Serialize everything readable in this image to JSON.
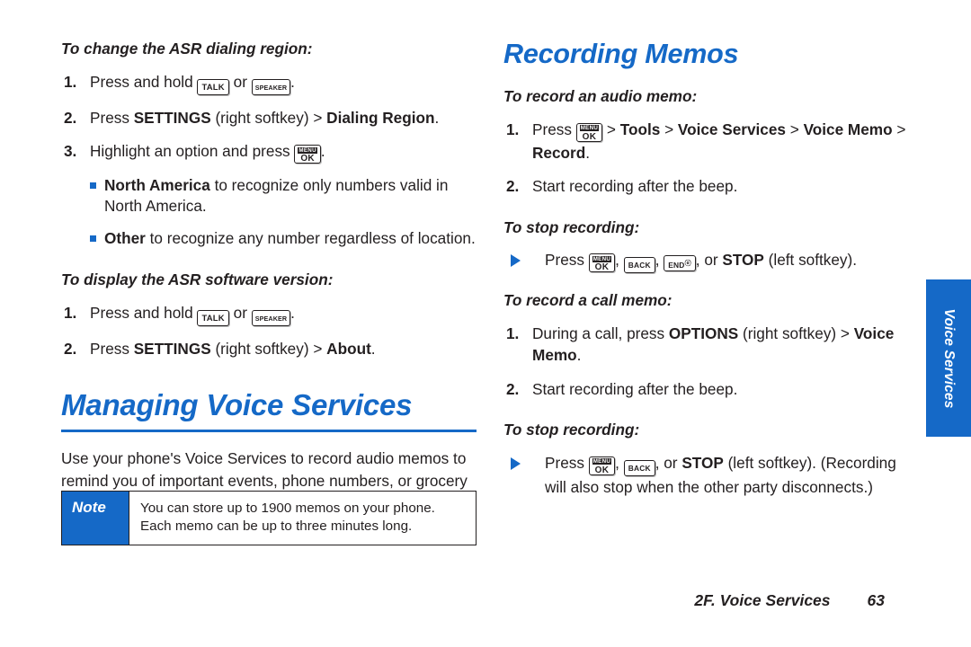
{
  "colors": {
    "accent": "#1569c7",
    "text": "#231f20",
    "page_bg": "#ffffff"
  },
  "left_column": {
    "proc1_heading": "To change the ASR dialing region:",
    "proc1_steps": {
      "s1_num": "1.",
      "s1_a": "Press and hold ",
      "s1_or": " or ",
      "s1_end": ".",
      "s2_num": "2.",
      "s2_a": "Press ",
      "s2_b1": "SETTINGS",
      "s2_c": " (right softkey) > ",
      "s2_b2": "Dialing Region",
      "s2_end": ".",
      "s3_num": "3.",
      "s3_a": "Highlight an option and press ",
      "s3_end": "."
    },
    "proc1_bullets": [
      {
        "bold": "North America",
        "rest": " to recognize only numbers valid in North America."
      },
      {
        "bold": "Other",
        "rest": " to recognize any number regardless of location."
      }
    ],
    "proc2_heading": "To display the ASR software version:",
    "proc2_steps": {
      "s1_num": "1.",
      "s1_a": "Press and hold ",
      "s1_or": " or ",
      "s1_end": ".",
      "s2_num": "2.",
      "s2_a": "Press ",
      "s2_b1": "SETTINGS",
      "s2_c": " (right softkey) > ",
      "s2_b2": "About",
      "s2_end": "."
    },
    "section_title": "Managing Voice Services",
    "intro_paragraph": "Use your phone's Voice Services to record audio memos to remind you of important events, phone numbers, or grocery list items, and to record call memos of the other party's voice during a phone call.",
    "note": {
      "label": "Note",
      "text": "You can store up to 1900 memos on your phone. Each memo can be up to three minutes long."
    }
  },
  "right_column": {
    "section_title": "Recording Memos",
    "proc1_heading": "To record an audio memo:",
    "proc1_steps": {
      "s1_num": "1.",
      "s1_a": "Press ",
      "s1_b": " > ",
      "s1_b1": "Tools",
      "s1_c": " > ",
      "s1_b2": "Voice Services",
      "s1_d": " > ",
      "s1_b3": "Voice Memo",
      "s1_e": " > ",
      "s1_b4": "Record",
      "s1_end": ".",
      "s2_num": "2.",
      "s2_text": "Start recording after the beep."
    },
    "proc2_heading": "To stop recording:",
    "proc2_step": {
      "a": "Press ",
      "sep1": ", ",
      "sep2": ", ",
      "sep3": ", or ",
      "stop": "STOP",
      "end": " (left softkey)."
    },
    "proc3_heading": "To record a call memo:",
    "proc3_steps": {
      "s1_num": "1.",
      "s1_a": "During a call, press ",
      "s1_b1": "OPTIONS",
      "s1_c": " (right softkey) > ",
      "s1_b2": "Voice Memo",
      "s1_end": ".",
      "s2_num": "2.",
      "s2_text": "Start recording after the beep."
    },
    "proc4_heading": "To stop recording:",
    "proc4_step": {
      "a": "Press ",
      "sep1": ", ",
      "sep2": ", or ",
      "stop": "STOP",
      "end": " (left softkey). (Recording will also stop when the other party disconnects.)"
    }
  },
  "side_tab": {
    "label": "Voice Services"
  },
  "footer": {
    "section": "2F. Voice Services",
    "page_number": "63"
  },
  "keys": {
    "talk": "TALK",
    "speaker": "SPEAKER",
    "back": "BACK",
    "end": "END",
    "end_power": "ⓞ",
    "menu": "MENU",
    "ok": "OK"
  }
}
